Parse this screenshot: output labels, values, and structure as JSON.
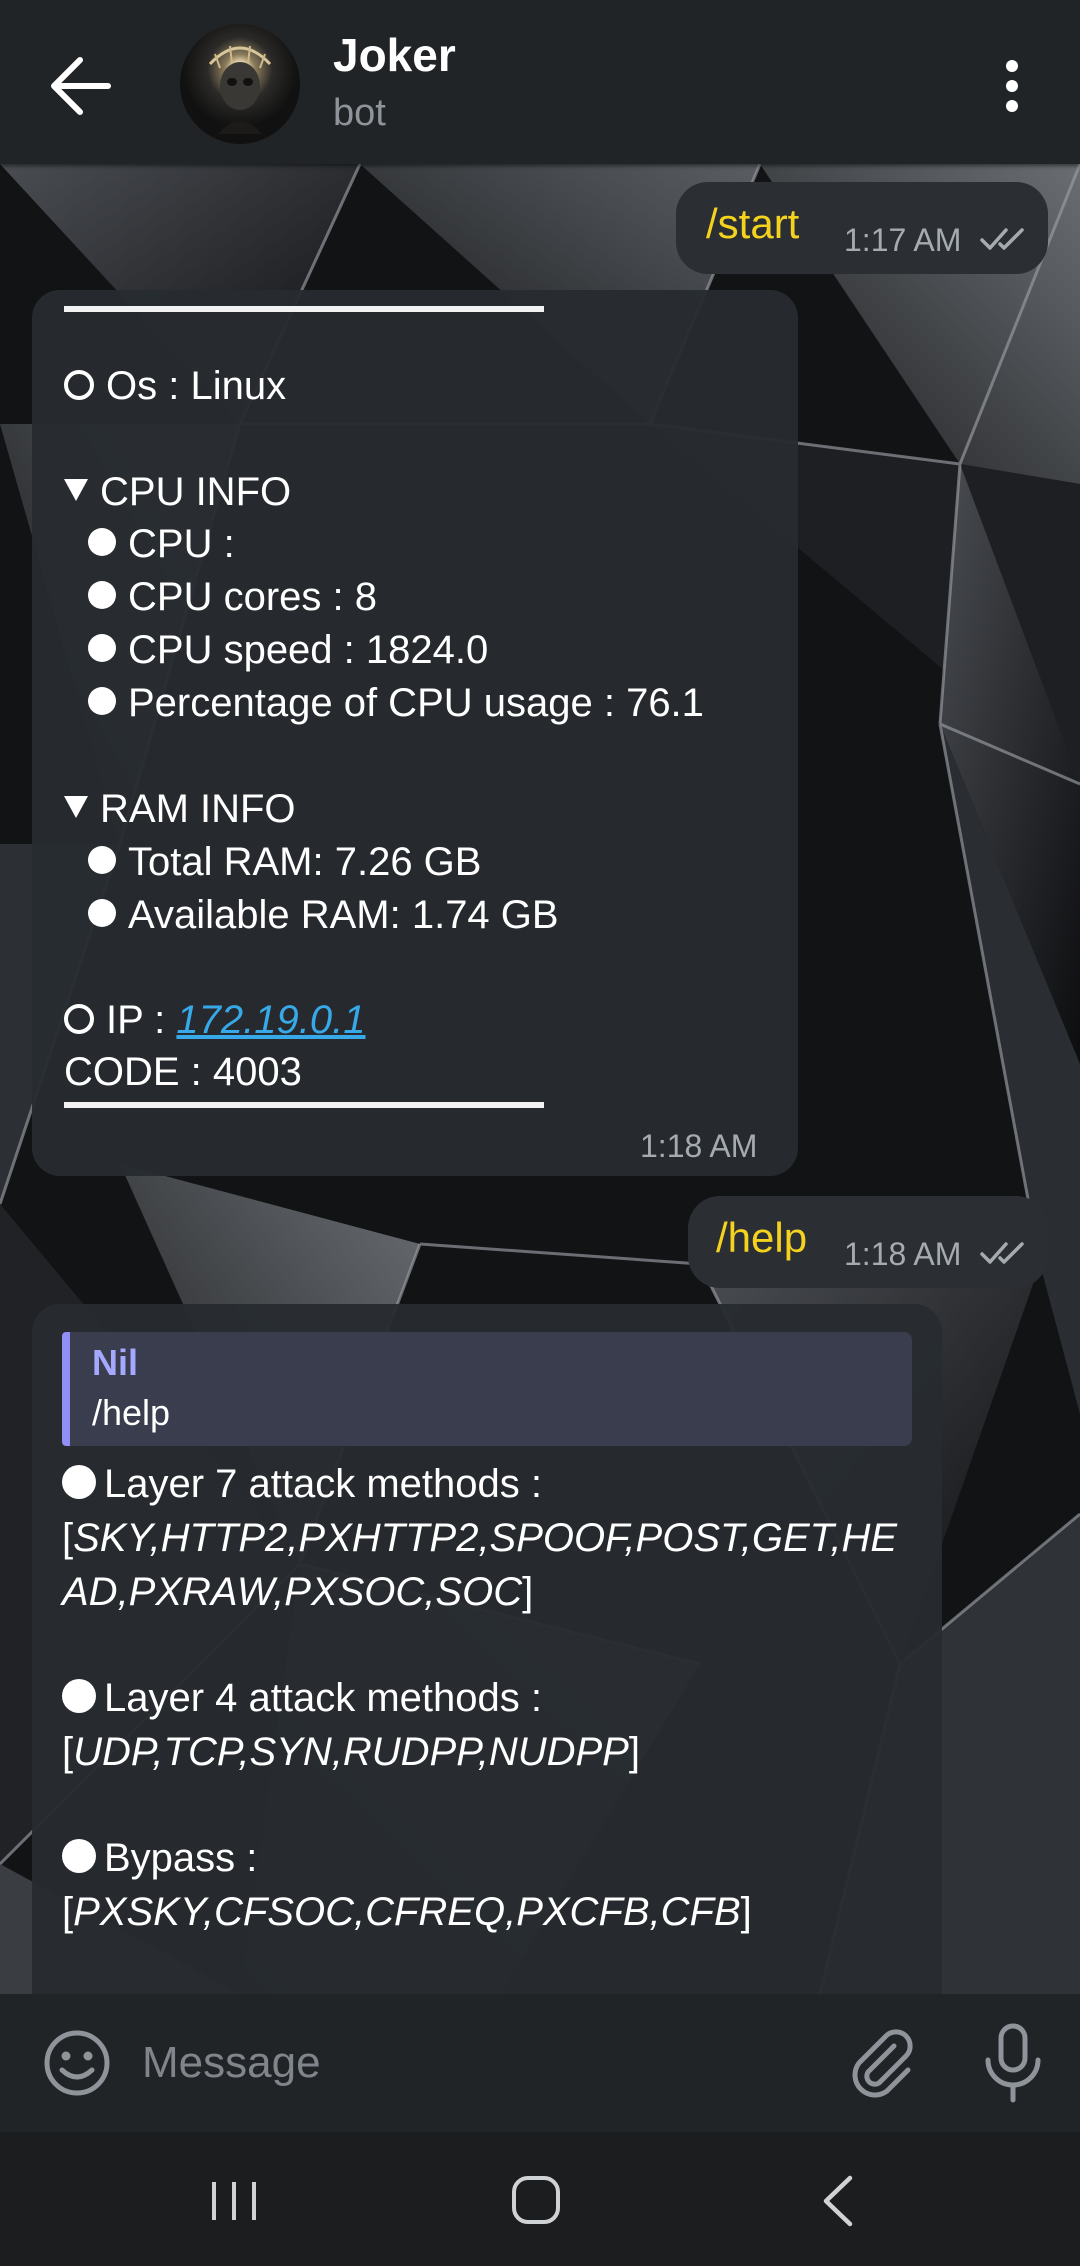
{
  "header": {
    "back_icon": "arrow-left-icon",
    "title": "Joker",
    "subtitle": "bot",
    "menu_icon": "more-vertical-icon"
  },
  "messages": {
    "m1": {
      "text": "/start",
      "time": "1:17 AM",
      "status_icon": "double-check-icon"
    },
    "m2": {
      "os": "Os : Linux",
      "cpu_header": "CPU INFO",
      "cpu": "CPU :",
      "cpu_cores": "CPU cores : 8",
      "cpu_speed": "CPU speed : 1824.0",
      "cpu_usage": "Percentage of CPU usage : 76.1",
      "ram_header": "RAM INFO",
      "ram_total": "Total RAM: 7.26 GB",
      "ram_available": "Available RAM: 1.74 GB",
      "ip_label": "IP : ",
      "ip_value": "172.19.0.1",
      "code": "CODE : 4003",
      "time": "1:18 AM"
    },
    "m3": {
      "text": "/help",
      "time": "1:18 AM",
      "status_icon": "double-check-icon"
    },
    "m4": {
      "reply_name": "Nil",
      "reply_text": "/help",
      "l7_title": "Layer 7 attack methods :",
      "l7_line1_bracket": "[",
      "l7_line1": "SKY,HTTP2,PXHTTP2,SPOOF,POST,GET,HE",
      "l7_line2": "AD,PXRAW,PXSOC,SOC",
      "l7_line2_bracket": "]",
      "l4_title": "Layer 4 attack methods :",
      "l4_open": "[",
      "l4_list": "UDP,TCP,SYN,RUDPP,NUDPP",
      "l4_close": "]",
      "bypass_title": "Bypass :",
      "bypass_open": "[",
      "bypass_list": "PXSKY,CFSOC,CFREQ,PXCFB,CFB",
      "bypass_close": "]"
    }
  },
  "input": {
    "placeholder": "Message",
    "emoji_icon": "smile-icon",
    "attach_icon": "paperclip-icon",
    "mic_icon": "microphone-icon"
  },
  "nav": {
    "recent_icon": "recent-apps-icon",
    "home_icon": "home-icon",
    "back_icon": "nav-back-icon"
  },
  "colors": {
    "accent_command": "#f4d21e",
    "link": "#37a9e8",
    "reply_bar": "#8f8ff5",
    "header_bg": "#212427"
  }
}
